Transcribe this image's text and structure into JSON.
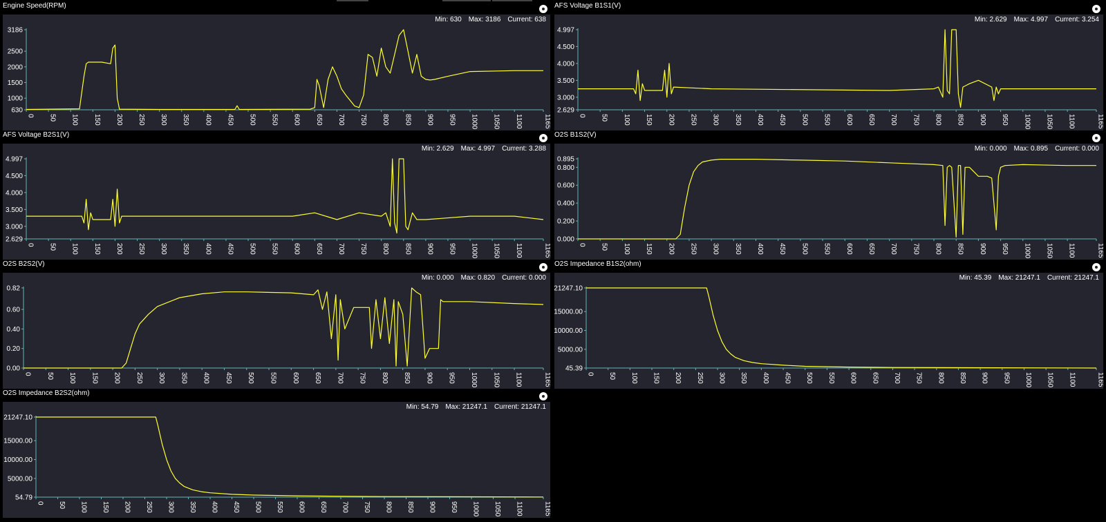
{
  "colors": {
    "background": "#000000",
    "plot_bg": "#25252f",
    "trace": "#ffff33",
    "axis": "#5fb8b8"
  },
  "panels": [
    {
      "title": "Engine Speed(RPM)",
      "min_label": "Min: 630",
      "max_label": "Max: 3186",
      "current_label": "Current: 638"
    },
    {
      "title": "AFS Voltage B1S1(V)",
      "min_label": "Min: 2.629",
      "max_label": "Max: 4.997",
      "current_label": "Current: 3.254"
    },
    {
      "title": "AFS Voltage B2S1(V)",
      "min_label": "Min: 2.629",
      "max_label": "Max: 4.997",
      "current_label": "Current: 3.288"
    },
    {
      "title": "O2S B1S2(V)",
      "min_label": "Min: 0.000",
      "max_label": "Max: 0.895",
      "current_label": "Current: 0.000"
    },
    {
      "title": "O2S B2S2(V)",
      "min_label": "Min: 0.000",
      "max_label": "Max: 0.820",
      "current_label": "Current: 0.000"
    },
    {
      "title": "O2S Impedance B1S2(ohm)",
      "min_label": "Min: 45.39",
      "max_label": "Max: 21247.1",
      "current_label": "Current: 21247.1"
    },
    {
      "title": "O2S Impedance B2S2(ohm)",
      "min_label": "Min: 54.79",
      "max_label": "Max: 21247.1",
      "current_label": "Current: 21247.1"
    }
  ],
  "chart_data": [
    {
      "type": "line",
      "title": "Engine Speed(RPM)",
      "xlim": [
        0,
        1165
      ],
      "x_ticks": [
        "0",
        "50",
        "100",
        "150",
        "200",
        "250",
        "300",
        "350",
        "400",
        "450",
        "500",
        "550",
        "600",
        "650",
        "700",
        "750",
        "800",
        "850",
        "900",
        "950",
        "1000",
        "1050",
        "1100",
        "1165"
      ],
      "ylim": [
        630,
        3186
      ],
      "y_tick_values": [
        630,
        1000,
        1500,
        2000,
        2500,
        3186
      ],
      "y_ticks": [
        "630",
        "1000",
        "1500",
        "2000",
        "2500",
        "3186"
      ],
      "series": [
        {
          "x": [
            0,
            120,
            130,
            135,
            140,
            170,
            190,
            195,
            200,
            205,
            210,
            300,
            470,
            475,
            480,
            640,
            650,
            655,
            660,
            670,
            680,
            690,
            700,
            710,
            720,
            740,
            750,
            760,
            770,
            780,
            790,
            800,
            810,
            820,
            830,
            840,
            850,
            860,
            870,
            880,
            890,
            900,
            910,
            920,
            950,
            1000,
            1100,
            1165
          ],
          "y": [
            640,
            660,
            1700,
            2100,
            2150,
            2150,
            2100,
            2600,
            2700,
            1000,
            650,
            640,
            640,
            760,
            640,
            650,
            700,
            1600,
            1400,
            700,
            1600,
            2000,
            1700,
            1300,
            1100,
            750,
            700,
            1100,
            2400,
            2300,
            1700,
            2600,
            2000,
            1800,
            2400,
            3000,
            3186,
            2500,
            1800,
            2400,
            1700,
            1600,
            1580,
            1600,
            1700,
            1850,
            1880,
            1880
          ]
        }
      ]
    },
    {
      "type": "line",
      "title": "AFS Voltage B1S1(V)",
      "xlim": [
        0,
        1165
      ],
      "x_ticks": [
        "0",
        "50",
        "100",
        "150",
        "200",
        "250",
        "300",
        "350",
        "400",
        "450",
        "500",
        "550",
        "600",
        "650",
        "700",
        "750",
        "800",
        "850",
        "900",
        "950",
        "1000",
        "1050",
        "1100",
        "1165"
      ],
      "ylim": [
        2.629,
        4.997
      ],
      "y_tick_values": [
        2.629,
        3.0,
        3.5,
        4.0,
        4.5,
        4.997
      ],
      "y_ticks": [
        "2.629",
        "3.000",
        "3.500",
        "4.000",
        "4.500",
        "4.997"
      ],
      "series": [
        {
          "x": [
            0,
            125,
            130,
            135,
            140,
            145,
            150,
            190,
            195,
            200,
            205,
            210,
            215,
            300,
            700,
            800,
            810,
            820,
            825,
            830,
            835,
            840,
            845,
            850,
            855,
            860,
            865,
            880,
            900,
            930,
            935,
            940,
            945,
            950,
            1000,
            1100,
            1165
          ],
          "y": [
            3.25,
            3.25,
            3.1,
            3.8,
            2.9,
            3.4,
            3.2,
            3.2,
            3.8,
            3.0,
            4.0,
            3.1,
            3.3,
            3.25,
            3.2,
            3.25,
            3.3,
            3.0,
            4.997,
            3.2,
            3.1,
            4.997,
            4.997,
            4.997,
            3.1,
            2.7,
            3.3,
            3.4,
            3.5,
            3.3,
            2.9,
            3.3,
            3.1,
            3.25,
            3.25,
            3.25,
            3.25
          ]
        }
      ]
    },
    {
      "type": "line",
      "title": "AFS Voltage B2S1(V)",
      "xlim": [
        0,
        1165
      ],
      "x_ticks": [
        "0",
        "50",
        "100",
        "150",
        "200",
        "250",
        "300",
        "350",
        "400",
        "450",
        "500",
        "550",
        "600",
        "650",
        "700",
        "750",
        "800",
        "850",
        "900",
        "950",
        "1000",
        "1050",
        "1100",
        "1165"
      ],
      "ylim": [
        2.629,
        4.997
      ],
      "y_tick_values": [
        2.629,
        3.0,
        3.5,
        4.0,
        4.5,
        4.997
      ],
      "y_ticks": [
        "2.629",
        "3.000",
        "3.500",
        "4.000",
        "4.500",
        "4.997"
      ],
      "series": [
        {
          "x": [
            0,
            125,
            130,
            135,
            140,
            145,
            150,
            190,
            195,
            200,
            205,
            210,
            215,
            300,
            600,
            650,
            700,
            750,
            800,
            810,
            820,
            825,
            830,
            835,
            840,
            845,
            850,
            855,
            860,
            870,
            880,
            900,
            1000,
            1100,
            1165
          ],
          "y": [
            3.3,
            3.3,
            3.1,
            3.8,
            2.9,
            3.4,
            3.2,
            3.2,
            3.8,
            3.0,
            4.1,
            3.1,
            3.3,
            3.3,
            3.3,
            3.4,
            3.2,
            3.4,
            3.3,
            3.4,
            3.0,
            4.997,
            3.1,
            2.8,
            4.997,
            4.997,
            4.997,
            3.0,
            2.9,
            3.4,
            3.2,
            3.2,
            3.3,
            3.3,
            3.2
          ]
        }
      ]
    },
    {
      "type": "line",
      "title": "O2S B1S2(V)",
      "xlim": [
        0,
        1165
      ],
      "x_ticks": [
        "0",
        "50",
        "100",
        "150",
        "200",
        "250",
        "300",
        "350",
        "400",
        "450",
        "500",
        "550",
        "600",
        "650",
        "700",
        "750",
        "800",
        "850",
        "900",
        "950",
        "1000",
        "1050",
        "1100",
        "1165"
      ],
      "ylim": [
        0.0,
        0.895
      ],
      "y_tick_values": [
        0.0,
        0.2,
        0.4,
        0.6,
        0.8,
        0.895
      ],
      "y_ticks": [
        "0.000",
        "0.200",
        "0.400",
        "0.600",
        "0.800",
        "0.895"
      ],
      "series": [
        {
          "x": [
            0,
            220,
            230,
            240,
            250,
            260,
            270,
            280,
            300,
            320,
            400,
            500,
            600,
            700,
            800,
            820,
            825,
            830,
            835,
            840,
            850,
            855,
            860,
            865,
            870,
            880,
            890,
            900,
            920,
            930,
            940,
            945,
            950,
            960,
            1000,
            1100,
            1165
          ],
          "y": [
            0,
            0,
            0.05,
            0.35,
            0.6,
            0.75,
            0.82,
            0.86,
            0.88,
            0.89,
            0.89,
            0.88,
            0.87,
            0.85,
            0.83,
            0.82,
            0.15,
            0.8,
            0.82,
            0.8,
            0.02,
            0.82,
            0.82,
            0.05,
            0.8,
            0.8,
            0.75,
            0.7,
            0.7,
            0.68,
            0.1,
            0.7,
            0.8,
            0.82,
            0.83,
            0.82,
            0.82
          ]
        }
      ]
    },
    {
      "type": "line",
      "title": "O2S B2S2(V)",
      "xlim": [
        0,
        1165
      ],
      "x_ticks": [
        "0",
        "50",
        "100",
        "150",
        "200",
        "250",
        "300",
        "350",
        "400",
        "450",
        "500",
        "550",
        "600",
        "650",
        "700",
        "750",
        "800",
        "850",
        "900",
        "950",
        "1000",
        "1050",
        "1100",
        "1165"
      ],
      "ylim": [
        0.0,
        0.82
      ],
      "y_tick_values": [
        0.0,
        0.2,
        0.4,
        0.6,
        0.82
      ],
      "y_ticks": [
        "0.00",
        "0.20",
        "0.40",
        "0.60",
        "0.82"
      ],
      "series": [
        {
          "x": [
            0,
            220,
            230,
            240,
            250,
            260,
            280,
            300,
            350,
            400,
            450,
            500,
            600,
            650,
            660,
            670,
            680,
            690,
            700,
            705,
            710,
            720,
            740,
            760,
            775,
            780,
            790,
            800,
            810,
            820,
            830,
            835,
            840,
            850,
            860,
            870,
            880,
            890,
            900,
            905,
            910,
            930,
            935,
            940,
            1000,
            1100,
            1165
          ],
          "y": [
            0,
            0,
            0.05,
            0.2,
            0.35,
            0.45,
            0.55,
            0.63,
            0.72,
            0.76,
            0.78,
            0.78,
            0.77,
            0.75,
            0.8,
            0.6,
            0.78,
            0.3,
            0.75,
            0.08,
            0.7,
            0.4,
            0.62,
            0.62,
            0.62,
            0.2,
            0.7,
            0.3,
            0.72,
            0.25,
            0.7,
            0.02,
            0.68,
            0.55,
            0.02,
            0.82,
            0.78,
            0.75,
            0.1,
            0.15,
            0.2,
            0.2,
            0.7,
            0.68,
            0.68,
            0.66,
            0.65
          ]
        }
      ]
    },
    {
      "type": "line",
      "title": "O2S Impedance B1S2(ohm)",
      "xlim": [
        0,
        1165
      ],
      "x_ticks": [
        "0",
        "50",
        "100",
        "150",
        "200",
        "250",
        "300",
        "350",
        "400",
        "450",
        "500",
        "550",
        "600",
        "650",
        "700",
        "750",
        "800",
        "850",
        "900",
        "950",
        "1000",
        "1050",
        "1100",
        "1165"
      ],
      "ylim": [
        45.39,
        21247.1
      ],
      "y_tick_values": [
        45.39,
        5000,
        10000,
        15000,
        21247.1
      ],
      "y_ticks": [
        "45.39",
        "5000.00",
        "10000.00",
        "15000.00",
        "21247.10"
      ],
      "series": [
        {
          "x": [
            0,
            275,
            280,
            290,
            300,
            310,
            320,
            330,
            340,
            360,
            380,
            400,
            450,
            500,
            600,
            700,
            800,
            1000,
            1165
          ],
          "y": [
            21247.1,
            21247.1,
            19000,
            14000,
            10000,
            7000,
            5000,
            3800,
            2900,
            2000,
            1500,
            1200,
            800,
            500,
            300,
            200,
            150,
            100,
            50
          ]
        }
      ]
    },
    {
      "type": "line",
      "title": "O2S Impedance B2S2(ohm)",
      "xlim": [
        0,
        1165
      ],
      "x_ticks": [
        "0",
        "50",
        "100",
        "150",
        "200",
        "250",
        "300",
        "350",
        "400",
        "450",
        "500",
        "550",
        "600",
        "650",
        "700",
        "750",
        "800",
        "850",
        "900",
        "950",
        "1000",
        "1050",
        "1100",
        "1165"
      ],
      "ylim": [
        54.79,
        21247.1
      ],
      "y_tick_values": [
        54.79,
        5000,
        10000,
        15000,
        21247.1
      ],
      "y_ticks": [
        "54.79",
        "5000.00",
        "10000.00",
        "15000.00",
        "21247.10"
      ],
      "series": [
        {
          "x": [
            0,
            275,
            280,
            290,
            300,
            310,
            320,
            330,
            340,
            360,
            380,
            400,
            450,
            500,
            600,
            700,
            800,
            1000,
            1165
          ],
          "y": [
            21247.1,
            21247.1,
            19000,
            14000,
            10000,
            7000,
            5000,
            3800,
            2900,
            2000,
            1500,
            1200,
            800,
            600,
            400,
            300,
            200,
            150,
            100
          ]
        }
      ]
    }
  ]
}
